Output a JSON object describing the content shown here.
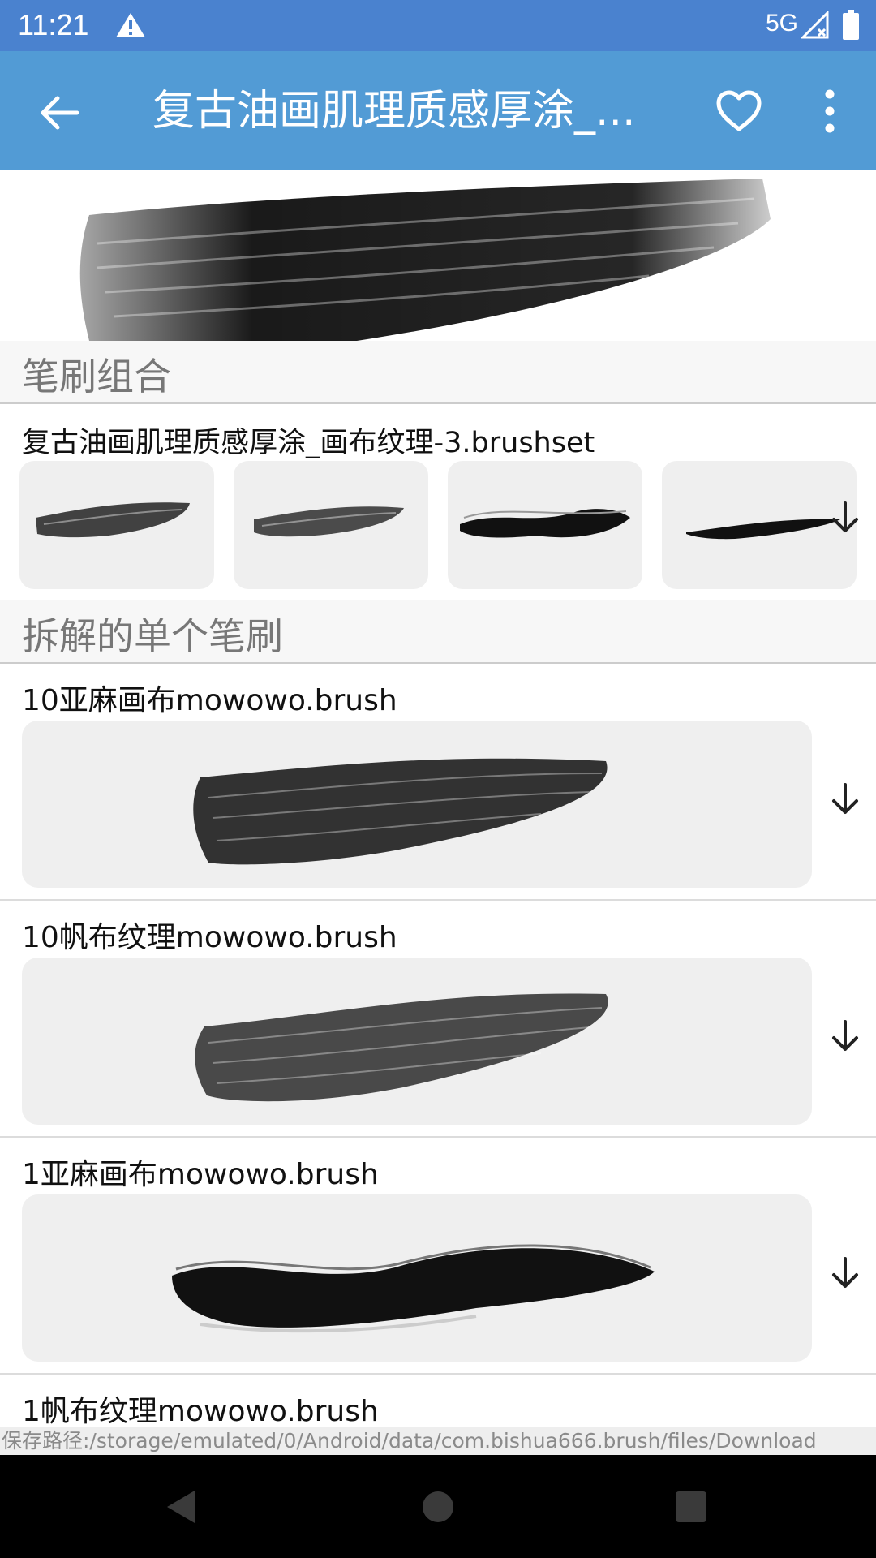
{
  "status_bar": {
    "time": "11:21",
    "network": "5G"
  },
  "app_bar": {
    "title": "复古油画肌理质感厚涂_..."
  },
  "sections": {
    "combo_header": "笔刷组合",
    "singles_header": "拆解的单个笔刷"
  },
  "brushset": {
    "file_name": "复古油画肌理质感厚涂_画布纹理-3.brushset",
    "thumbnail_count": 4
  },
  "brushes": [
    {
      "name": "10亚麻画布mowowo.brush"
    },
    {
      "name": "10帆布纹理mowowo.brush"
    },
    {
      "name": "1亚麻画布mowowo.brush"
    },
    {
      "name": "1帆布纹理mowowo.brush"
    }
  ],
  "footer": {
    "save_path": "保存路径:/storage/emulated/0/Android/data/com.bishua666.brush/files/Download"
  },
  "icons": [
    "warning-icon",
    "signal-icon",
    "battery-icon",
    "back-arrow-icon",
    "heart-icon",
    "more-vert-icon",
    "download-icon",
    "nav-back-icon",
    "nav-home-icon",
    "nav-recents-icon"
  ],
  "colors": {
    "status_bar": "#4a82cf",
    "app_bar": "#529bd5",
    "preview_bg": "#efefef"
  }
}
